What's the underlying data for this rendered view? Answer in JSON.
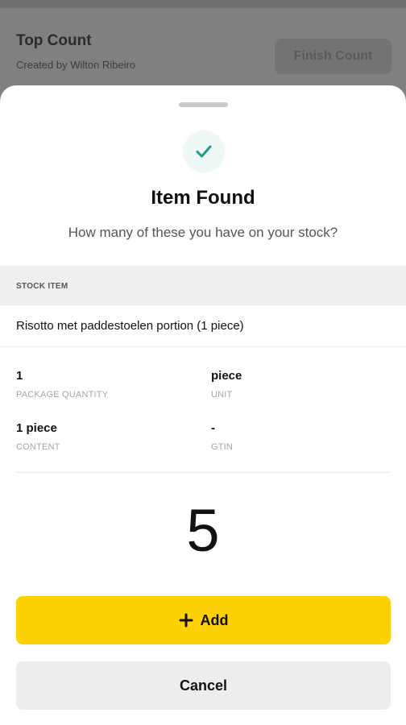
{
  "background": {
    "title": "Top Count",
    "subtitle": "Created by Wilton Ribeiro",
    "finish_button_label": "Finish Count"
  },
  "sheet": {
    "icon": "check-icon",
    "accent_color": "#1a9c8a",
    "title": "Item Found",
    "question": "How many of these you have on your stock?",
    "section_label": "STOCK ITEM",
    "item_name": "Risotto met paddestoelen portion (1 piece)",
    "fields": {
      "package_quantity": {
        "value": "1",
        "label": "PACKAGE QUANTITY"
      },
      "unit": {
        "value": "piece",
        "label": "UNIT"
      },
      "content": {
        "value": "1 piece",
        "label": "CONTENT"
      },
      "gtin": {
        "value": "-",
        "label": "GTIN"
      }
    },
    "count": "5",
    "add_button_label": "Add",
    "add_button_color": "#fdd103",
    "cancel_button_label": "Cancel"
  }
}
